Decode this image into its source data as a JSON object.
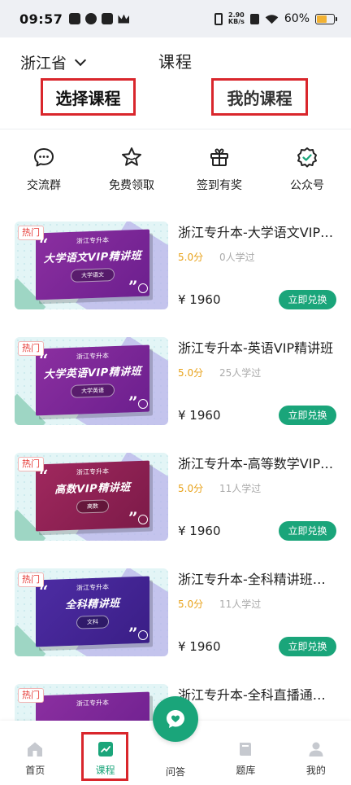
{
  "status_bar": {
    "time": "09:57",
    "net_speed_value": "2.90",
    "net_speed_unit": "KB/s",
    "battery": "60%",
    "battery_level": 0.6
  },
  "header": {
    "province": "浙江省",
    "title": "课程",
    "tabs": [
      {
        "label": "选择课程"
      },
      {
        "label": "我的课程"
      }
    ]
  },
  "quick_menu": [
    {
      "label": "交流群",
      "icon": "chat-icon"
    },
    {
      "label": "免费领取",
      "icon": "star-icon"
    },
    {
      "label": "签到有奖",
      "icon": "gift-icon"
    },
    {
      "label": "公众号",
      "icon": "badge-check-icon"
    }
  ],
  "courses": [
    {
      "hot": "热门",
      "thumb_sub": "浙江专升本",
      "thumb_main": "大学语文VIP精讲班",
      "thumb_tag": "大学语文",
      "title": "浙江专升本-大学语文VIP精讲班",
      "score": "5.0分",
      "learners": "0人学过",
      "price": "¥ 1960",
      "button": "立即兑换",
      "board_color": "#7c2796"
    },
    {
      "hot": "热门",
      "thumb_sub": "浙江专升本",
      "thumb_main": "大学英语VIP精讲班",
      "thumb_tag": "大学英语",
      "title": "浙江专升本-英语VIP精讲班",
      "score": "5.0分",
      "learners": "25人学过",
      "price": "¥ 1960",
      "button": "立即兑换",
      "board_color": "#7c2796"
    },
    {
      "hot": "热门",
      "thumb_sub": "浙江专升本",
      "thumb_main": "高数VIP精讲班",
      "thumb_tag": "高数",
      "title": "浙江专升本-高等数学VIP精讲班",
      "score": "5.0分",
      "learners": "11人学过",
      "price": "¥ 1960",
      "button": "立即兑换",
      "board_color": "#8e2152"
    },
    {
      "hot": "热门",
      "thumb_sub": "浙江专升本",
      "thumb_main": "全科精讲班",
      "thumb_tag": "文科",
      "title": "浙江专升本-全科精讲班（文科）",
      "score": "5.0分",
      "learners": "11人学过",
      "price": "¥ 1960",
      "button": "立即兑换",
      "board_color": "#442596"
    },
    {
      "hot": "热门",
      "thumb_sub": "浙江专升本",
      "thumb_main": "",
      "thumb_tag": "",
      "title": "浙江专升本-全科直播通关班",
      "score": "",
      "learners": "",
      "price": "",
      "button": "",
      "board_color": "#7c2796"
    }
  ],
  "bottom_nav": [
    {
      "label": "首页",
      "icon": "home-icon"
    },
    {
      "label": "课程",
      "icon": "course-chart-icon",
      "active": true
    },
    {
      "label": "问答",
      "icon": "qa-heart-icon"
    },
    {
      "label": "题库",
      "icon": "book-icon"
    },
    {
      "label": "我的",
      "icon": "user-icon"
    }
  ],
  "colors": {
    "accent": "#1aa57a",
    "score": "#e8a21a",
    "highlight_box": "#d9262c"
  }
}
